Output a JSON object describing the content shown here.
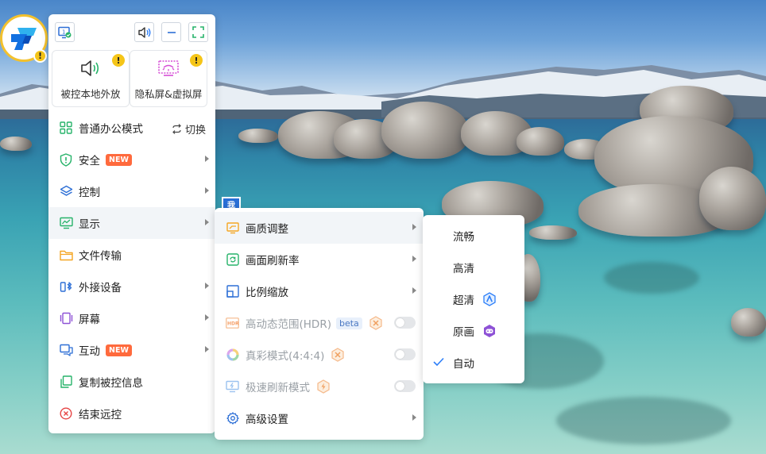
{
  "colors": {
    "accent": "#2d7ff9",
    "new_badge": "#ff6a3d",
    "warning": "#f5c518"
  },
  "logo": {
    "icon": "app-logo-icon",
    "badge": "!"
  },
  "topbar": {
    "icons": [
      "monitor-check-icon",
      "speaker-icon",
      "minimize-icon",
      "fullscreen-icon"
    ]
  },
  "cards": [
    {
      "label": "被控本地外放",
      "icon": "speaker-wave-icon",
      "badge": "!"
    },
    {
      "label": "隐私屏&虚拟屏",
      "icon": "privacy-screen-icon",
      "badge": "!"
    }
  ],
  "menu": {
    "items": [
      {
        "label": "普通办公模式",
        "icon": "grid-icon",
        "action": "切换"
      },
      {
        "label": "安全",
        "icon": "shield-icon",
        "badge": "NEW"
      },
      {
        "label": "控制",
        "icon": "layers-icon"
      },
      {
        "label": "显示",
        "icon": "monitor-chart-icon"
      },
      {
        "label": "文件传输",
        "icon": "folder-icon"
      },
      {
        "label": "外接设备",
        "icon": "bluetooth-device-icon"
      },
      {
        "label": "屏幕",
        "icon": "screen-icon"
      },
      {
        "label": "互动",
        "icon": "chat-icon",
        "badge": "NEW"
      },
      {
        "label": "复制被控信息",
        "icon": "copy-icon"
      },
      {
        "label": "结束远控",
        "icon": "close-circle-icon"
      }
    ]
  },
  "display_submenu": {
    "items": [
      {
        "label": "画质调整",
        "icon": "picture-quality-icon"
      },
      {
        "label": "画面刷新率",
        "icon": "refresh-icon"
      },
      {
        "label": "比例缩放",
        "icon": "scale-icon"
      },
      {
        "label": "高动态范围(HDR)",
        "icon": "hdr-icon",
        "tag": "beta"
      },
      {
        "label": "真彩模式(4:4:4)",
        "icon": "color-wheel-icon"
      },
      {
        "label": "极速刷新模式",
        "icon": "lightning-monitor-icon"
      },
      {
        "label": "高级设置",
        "icon": "gear-icon"
      }
    ]
  },
  "quality_submenu": {
    "items": [
      {
        "label": "流畅"
      },
      {
        "label": "高清"
      },
      {
        "label": "超清",
        "icon": "vip-a-icon"
      },
      {
        "label": "原画",
        "icon": "vip-game-icon"
      },
      {
        "label": "自动",
        "checked": true
      }
    ]
  },
  "overlay_tag": "我"
}
